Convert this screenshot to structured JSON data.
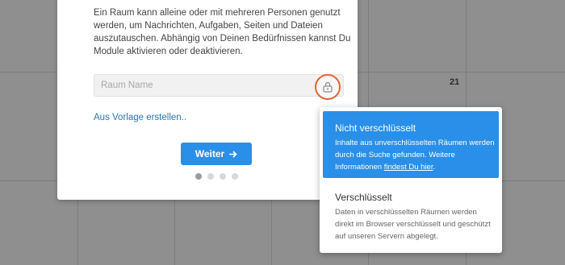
{
  "modal": {
    "description": "Ein Raum kann alleine oder mit mehreren Personen genutzt werden, um Nachrichten, Aufgaben, Seiten und Dateien auszutauschen. Abhängig von Deinen Bedürfnissen kannst Du Module aktivieren oder deaktivieren.",
    "room_name_placeholder": "Raum Name",
    "room_name_value": "",
    "template_link": "Aus Vorlage erstellen..",
    "next_button": "Weiter",
    "next_icon": "arrow-right-icon",
    "lock_icon": "lock-icon",
    "steps_total": 4,
    "step_active": 1
  },
  "calendar": {
    "visible_day": "21"
  },
  "encryption_dropdown": {
    "options": [
      {
        "title": "Nicht verschlüsselt",
        "desc_before_link": "Inhalte aus unverschlüsselten Räumen werden durch die Suche gefunden. Weitere Informationen ",
        "link": "findest Du hier",
        "desc_after_link": ".",
        "selected": true
      },
      {
        "title": "Verschlüsselt",
        "description": "Daten in verschlüsselten Räumen werden direkt im Browser verschlüsselt und geschützt auf unseren Servern abgelegt.",
        "selected": false
      }
    ]
  },
  "colors": {
    "accent": "#2a8fe8",
    "lock_ring": "#e0663a",
    "link": "#2775b6"
  }
}
